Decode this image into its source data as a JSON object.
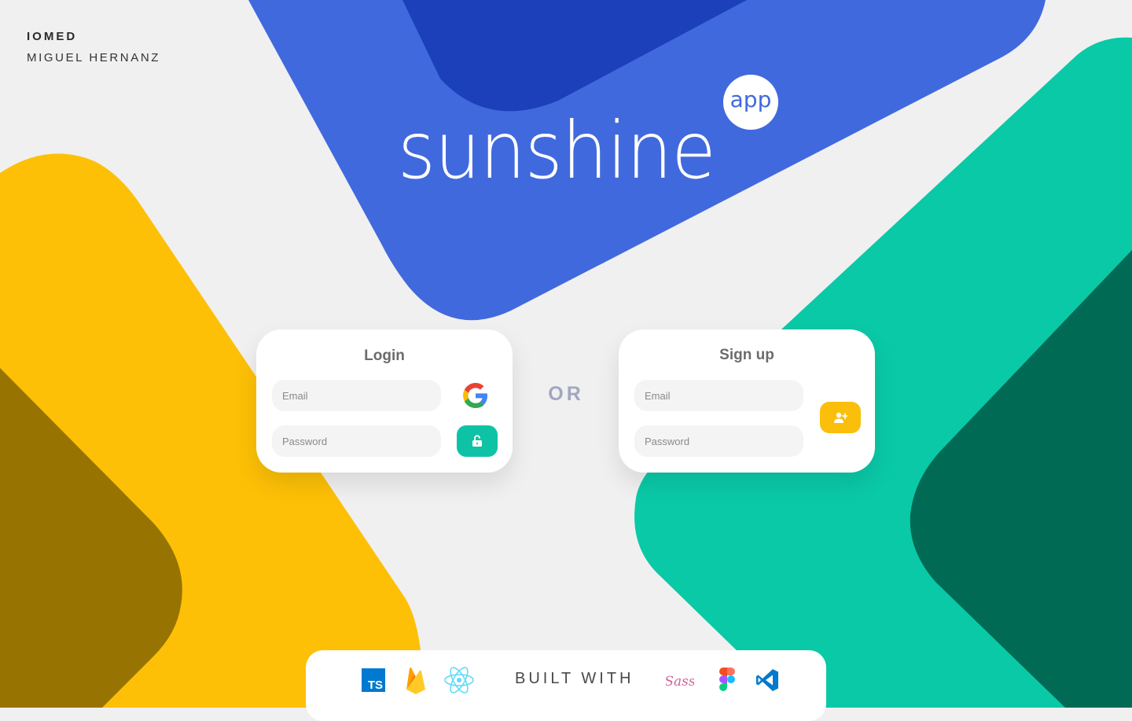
{
  "brand": {
    "company": "IOMED",
    "author": "MIGUEL HERNANZ"
  },
  "logo": {
    "word": "sunshine",
    "badge": "app"
  },
  "login": {
    "title": "Login",
    "email_placeholder": "Email",
    "password_placeholder": "Password",
    "google_icon": "google-logo-icon",
    "submit_icon": "unlock-icon"
  },
  "divider": "OR",
  "signup": {
    "title": "Sign up",
    "email_placeholder": "Email",
    "password_placeholder": "Password",
    "submit_icon": "add-user-icon"
  },
  "built_with": {
    "label": "BUILT WITH",
    "left_tech": [
      "TypeScript",
      "Firebase",
      "React"
    ],
    "right_tech": [
      "Sass",
      "Figma",
      "VS Code"
    ],
    "ts_badge": "TS",
    "sass_text": "Sass"
  },
  "colors": {
    "background": "#f0f0f0",
    "blue": "#4169de",
    "dark_blue": "#1c40b9",
    "yellow": "#fdc006",
    "dark_yellow": "#977402",
    "green": "#0ac9a7",
    "dark_green": "#006a55",
    "or_text": "#a2a7c0"
  }
}
